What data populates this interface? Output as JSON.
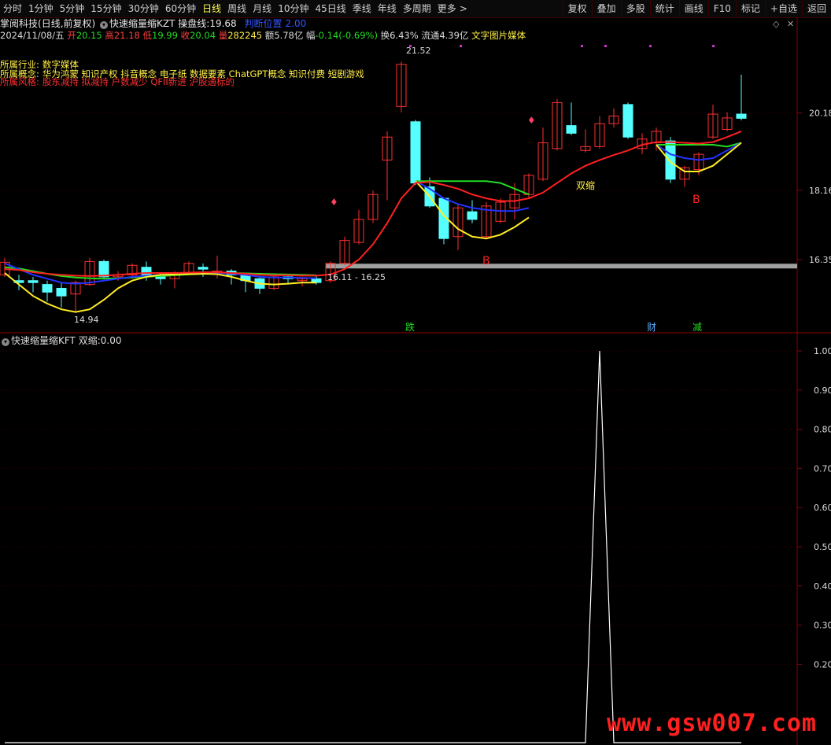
{
  "toolbar": {
    "tabs": [
      "分时",
      "1分钟",
      "5分钟",
      "15分钟",
      "30分钟",
      "60分钟",
      "日线",
      "周线",
      "月线",
      "10分钟",
      "45日线",
      "季线",
      "年线",
      "多周期",
      "更多"
    ],
    "active_tab": "日线",
    "more_arrow": ">",
    "tools": [
      "复权",
      "叠加",
      "多股",
      "统计",
      "画线",
      "F10",
      "标记",
      "+自选",
      "返回"
    ]
  },
  "header": {
    "stock_name": "掌阅科技",
    "period_note": "(日线,前复权)",
    "indicator_name": "快速缩量缩KZT",
    "indicator_label": "操盘线:",
    "indicator_value": "19.68",
    "indicator_tag": "判断位置",
    "indicator_tag_value": "2.00"
  },
  "quote": {
    "date": "2024/11/08/五",
    "open_label": "开",
    "open": "20.15",
    "high_label": "高",
    "high": "21.18",
    "low_label": "低",
    "low": "19.99",
    "close_label": "收",
    "close": "20.04",
    "volume_label": "量",
    "volume": "282245",
    "amount_label": "额",
    "amount": "5.78亿",
    "change_label": "幅",
    "change": "-0.14(-0.69%)",
    "turnover_label": "换",
    "turnover": "6.43%",
    "float_label": "流通",
    "float": "4.39亿",
    "sector": "文字图片媒体"
  },
  "profile": {
    "industry_label": "所属行业:",
    "industry": "数字媒体",
    "concepts_label": "所属概念:",
    "concepts": "华为鸿蒙 知识产权 抖音概念 电子纸 数据要素 ChatGPT概念 知识付费 短剧游戏",
    "style_label": "所属风格:",
    "style": "股东减持 拟减持 户数减少 QFII新进 沪股通标的"
  },
  "annotations": {
    "high_price": "21.52",
    "low_price": "14.94",
    "range_label": "16.11 - 16.25",
    "double_shrink": "双缩",
    "buy_mark_1": "B",
    "buy_mark_2": "B",
    "event_1": "跌",
    "event_2": "财",
    "event_3": "减"
  },
  "price_axis": [
    "20.18",
    "18.16",
    "16.35"
  ],
  "indicator_panel": {
    "name": "快速缩量缩KFT",
    "series_label": "双缩:",
    "series_value": "0.00",
    "axis": [
      "1.00",
      "0.90",
      "0.80",
      "0.70",
      "0.60",
      "0.50",
      "0.40",
      "0.30",
      "0.20"
    ]
  },
  "colors": {
    "up": "#ff3030",
    "down": "#55ffff",
    "ma_red": "#ff2020",
    "ma_green": "#22dd22",
    "ma_blue": "#2233ff",
    "ma_yellow": "#ffee22",
    "grid": "#3a0000"
  },
  "chart_data": {
    "type": "candlestick",
    "ylim": [
      14.5,
      22.0
    ],
    "candles": [
      {
        "o": 15.95,
        "c": 16.28,
        "h": 16.4,
        "l": 15.9
      },
      {
        "o": 15.8,
        "c": 15.75,
        "h": 15.95,
        "l": 15.55
      },
      {
        "o": 15.8,
        "c": 15.75,
        "h": 15.9,
        "l": 15.5
      },
      {
        "o": 15.7,
        "c": 15.5,
        "h": 15.8,
        "l": 15.25
      },
      {
        "o": 15.6,
        "c": 15.4,
        "h": 15.75,
        "l": 15.1
      },
      {
        "o": 15.45,
        "c": 15.75,
        "h": 15.8,
        "l": 15.0
      },
      {
        "o": 15.7,
        "c": 16.3,
        "h": 16.4,
        "l": 15.65
      },
      {
        "o": 16.3,
        "c": 15.9,
        "h": 16.35,
        "l": 15.85
      },
      {
        "o": 15.9,
        "c": 15.95,
        "h": 16.05,
        "l": 15.8
      },
      {
        "o": 15.95,
        "c": 16.2,
        "h": 16.25,
        "l": 15.85
      },
      {
        "o": 16.15,
        "c": 15.95,
        "h": 16.3,
        "l": 15.8
      },
      {
        "o": 15.9,
        "c": 15.85,
        "h": 16.0,
        "l": 15.7
      },
      {
        "o": 15.85,
        "c": 16.0,
        "h": 16.05,
        "l": 15.6
      },
      {
        "o": 16.0,
        "c": 16.25,
        "h": 16.3,
        "l": 15.95
      },
      {
        "o": 16.15,
        "c": 16.1,
        "h": 16.25,
        "l": 15.9
      },
      {
        "o": 16.0,
        "c": 16.05,
        "h": 16.45,
        "l": 15.85
      },
      {
        "o": 16.05,
        "c": 15.95,
        "h": 16.1,
        "l": 15.7
      },
      {
        "o": 15.95,
        "c": 15.8,
        "h": 16.0,
        "l": 15.5
      },
      {
        "o": 15.85,
        "c": 15.6,
        "h": 15.9,
        "l": 15.45
      },
      {
        "o": 15.6,
        "c": 15.9,
        "h": 15.95,
        "l": 15.55
      },
      {
        "o": 15.9,
        "c": 15.85,
        "h": 15.95,
        "l": 15.7
      },
      {
        "o": 15.8,
        "c": 15.85,
        "h": 15.9,
        "l": 15.65
      },
      {
        "o": 15.85,
        "c": 15.75,
        "h": 15.95,
        "l": 15.7
      },
      {
        "o": 15.8,
        "c": 16.25,
        "h": 16.3,
        "l": 15.75
      },
      {
        "o": 16.25,
        "c": 16.85,
        "h": 16.95,
        "l": 16.2
      },
      {
        "o": 16.8,
        "c": 17.4,
        "h": 17.65,
        "l": 16.75
      },
      {
        "o": 17.4,
        "c": 18.05,
        "h": 18.15,
        "l": 17.3
      },
      {
        "o": 18.95,
        "c": 19.55,
        "h": 19.7,
        "l": 17.9
      },
      {
        "o": 20.35,
        "c": 21.45,
        "h": 21.52,
        "l": 20.2
      },
      {
        "o": 19.95,
        "c": 18.35,
        "h": 20.0,
        "l": 18.3
      },
      {
        "o": 18.25,
        "c": 17.75,
        "h": 18.5,
        "l": 17.7
      },
      {
        "o": 17.95,
        "c": 16.9,
        "h": 17.95,
        "l": 16.75
      },
      {
        "o": 16.95,
        "c": 17.7,
        "h": 17.8,
        "l": 16.6
      },
      {
        "o": 17.6,
        "c": 17.4,
        "h": 17.9,
        "l": 17.3
      },
      {
        "o": 16.95,
        "c": 17.75,
        "h": 17.85,
        "l": 16.9
      },
      {
        "o": 17.35,
        "c": 17.85,
        "h": 17.95,
        "l": 17.3
      },
      {
        "o": 17.7,
        "c": 18.05,
        "h": 18.35,
        "l": 17.4
      },
      {
        "o": 18.05,
        "c": 18.55,
        "h": 18.6,
        "l": 17.95
      },
      {
        "o": 18.45,
        "c": 19.4,
        "h": 19.8,
        "l": 18.4
      },
      {
        "o": 19.25,
        "c": 20.45,
        "h": 20.55,
        "l": 19.2
      },
      {
        "o": 19.85,
        "c": 19.65,
        "h": 20.45,
        "l": 19.6
      },
      {
        "o": 19.2,
        "c": 19.3,
        "h": 19.75,
        "l": 19.15
      },
      {
        "o": 19.3,
        "c": 19.9,
        "h": 20.1,
        "l": 19.25
      },
      {
        "o": 19.9,
        "c": 20.1,
        "h": 20.3,
        "l": 19.8
      },
      {
        "o": 20.4,
        "c": 19.55,
        "h": 20.45,
        "l": 19.5
      },
      {
        "o": 19.25,
        "c": 19.5,
        "h": 19.65,
        "l": 19.1
      },
      {
        "o": 19.4,
        "c": 19.7,
        "h": 19.8,
        "l": 19.2
      },
      {
        "o": 19.45,
        "c": 18.45,
        "h": 19.55,
        "l": 18.35
      },
      {
        "o": 18.45,
        "c": 18.75,
        "h": 18.8,
        "l": 18.25
      },
      {
        "o": 18.7,
        "c": 19.1,
        "h": 19.15,
        "l": 18.55
      },
      {
        "o": 19.55,
        "c": 20.15,
        "h": 20.4,
        "l": 19.5
      },
      {
        "o": 19.75,
        "c": 20.05,
        "h": 20.2,
        "l": 19.7
      },
      {
        "o": 20.15,
        "c": 20.04,
        "h": 21.18,
        "l": 19.99
      }
    ],
    "ma_red": [
      16.1,
      16.08,
      16.02,
      15.98,
      15.95,
      15.93,
      15.92,
      15.93,
      15.95,
      15.98,
      16.0,
      16.0,
      16.0,
      16.01,
      16.02,
      16.02,
      16.0,
      15.98,
      15.95,
      15.94,
      15.94,
      15.93,
      15.93,
      15.96,
      16.1,
      16.35,
      16.75,
      17.3,
      17.95,
      18.35,
      18.38,
      18.3,
      18.2,
      18.05,
      17.95,
      17.88,
      17.88,
      17.95,
      18.1,
      18.35,
      18.6,
      18.8,
      18.95,
      19.08,
      19.2,
      19.35,
      19.42,
      19.42,
      19.4,
      19.38,
      19.42,
      19.55,
      19.7
    ],
    "ma_green": [
      16.15,
      16.12,
      16.05,
      15.98,
      15.92,
      15.88,
      15.86,
      15.85,
      15.86,
      15.88,
      15.9,
      15.92,
      15.94,
      15.96,
      15.98,
      16.0,
      16.0,
      15.99,
      15.98,
      15.97,
      15.96,
      15.95,
      15.94,
      null,
      null,
      null,
      null,
      null,
      null,
      18.4,
      18.4,
      18.4,
      18.4,
      18.4,
      18.4,
      18.35,
      18.2,
      18.05,
      null,
      null,
      null,
      null,
      null,
      null,
      null,
      null,
      19.35,
      19.35,
      19.35,
      19.35,
      19.35,
      19.3,
      19.4
    ],
    "ma_blue": [
      16.25,
      16.1,
      15.95,
      15.85,
      15.75,
      15.72,
      15.75,
      15.8,
      15.85,
      15.9,
      15.93,
      15.95,
      15.97,
      15.98,
      15.99,
      16.0,
      15.98,
      15.95,
      15.9,
      15.88,
      15.88,
      15.87,
      15.86,
      null,
      null,
      null,
      null,
      null,
      null,
      18.4,
      18.2,
      17.95,
      17.8,
      17.7,
      17.65,
      17.62,
      17.62,
      17.7,
      null,
      null,
      null,
      null,
      null,
      null,
      null,
      null,
      19.35,
      19.1,
      19.0,
      18.95,
      19.0,
      19.2,
      19.4
    ],
    "ma_yellow": [
      16.0,
      15.7,
      15.4,
      15.2,
      15.05,
      14.98,
      15.05,
      15.3,
      15.6,
      15.8,
      15.9,
      15.95,
      15.96,
      15.97,
      15.98,
      15.97,
      15.9,
      15.8,
      15.72,
      15.7,
      15.72,
      15.75,
      15.75,
      null,
      null,
      null,
      null,
      null,
      null,
      18.4,
      18.0,
      17.5,
      17.15,
      16.95,
      16.9,
      17.0,
      17.2,
      17.45,
      null,
      null,
      null,
      null,
      null,
      null,
      null,
      null,
      19.35,
      18.9,
      18.65,
      18.65,
      18.8,
      19.1,
      19.4
    ],
    "indicator_values": [
      0,
      0,
      0,
      0,
      0,
      0,
      0,
      0,
      0,
      0,
      0,
      0,
      0,
      0,
      0,
      0,
      0,
      0,
      0,
      0,
      0,
      0,
      0,
      0,
      0,
      0,
      0,
      0,
      0,
      0,
      0,
      0,
      0,
      0,
      0,
      0,
      0,
      0,
      0,
      0,
      0,
      0,
      1,
      0,
      0,
      0,
      0,
      0,
      0,
      0,
      0,
      0,
      0
    ],
    "indicator_ylim": [
      0,
      1.0
    ]
  }
}
